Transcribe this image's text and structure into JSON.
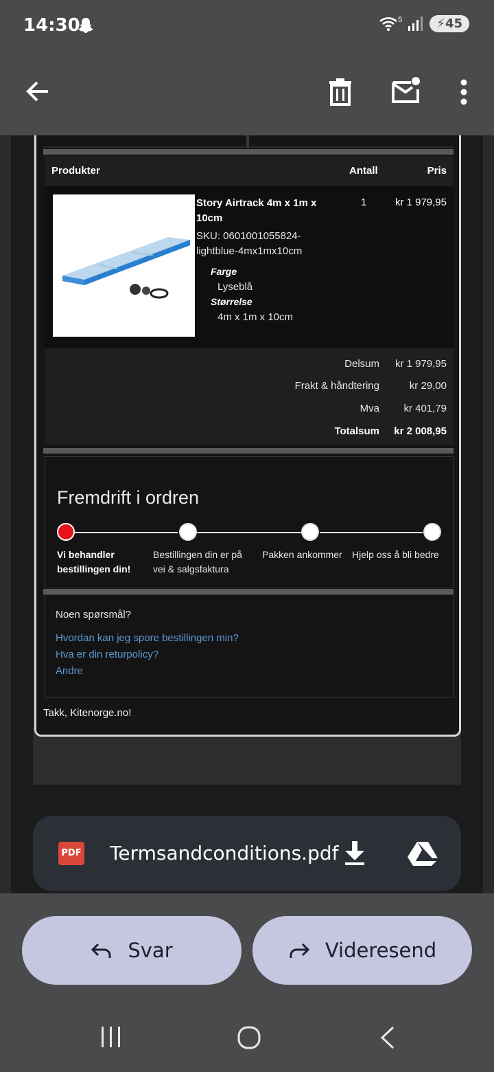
{
  "status": {
    "time": "14:30",
    "signal_label": "5",
    "battery": "45"
  },
  "order": {
    "headers": {
      "product": "Produkter",
      "qty": "Antall",
      "price": "Pris"
    },
    "item": {
      "name": "Story Airtrack 4m x 1m x 10cm",
      "sku": "SKU: 0601001055824-lightblue-4mx1mx10cm",
      "attr1_key": "Farge",
      "attr1_val": "Lyseblå",
      "attr2_key": "Størrelse",
      "attr2_val": "4m x 1m x 10cm",
      "qty": "1",
      "price": "kr 1 979,95"
    },
    "totals": {
      "subtotal_label": "Delsum",
      "subtotal": "kr 1 979,95",
      "shipping_label": "Frakt & håndtering",
      "shipping": "kr 29,00",
      "vat_label": "Mva",
      "vat": "kr 401,79",
      "total_label": "Totalsum",
      "total": "kr 2 008,95"
    }
  },
  "progress": {
    "title": "Fremdrift i ordren",
    "step1": "Vi behandler bestillingen din!",
    "step2": "Bestillingen din er på vei & salgsfaktura",
    "step3": "Pakken ankommer",
    "step4": "Hjelp oss å bli bedre",
    "current_step": 1
  },
  "faq": {
    "question": "Noen spørsmål?",
    "link1": "Hvordan kan jeg spore bestillingen min?",
    "link2": "Hva er din returpolicy?",
    "link3": "Andre"
  },
  "thanks": "Takk, Kitenorge.no!",
  "attachment": {
    "badge": "PDF",
    "filename": "Termsandconditions.pdf"
  },
  "actions": {
    "reply": "Svar",
    "forward": "Videresend"
  },
  "colors": {
    "accent_pill": "#c4c7df",
    "link": "#5b9bd5",
    "active_dot": "#e8121b"
  }
}
